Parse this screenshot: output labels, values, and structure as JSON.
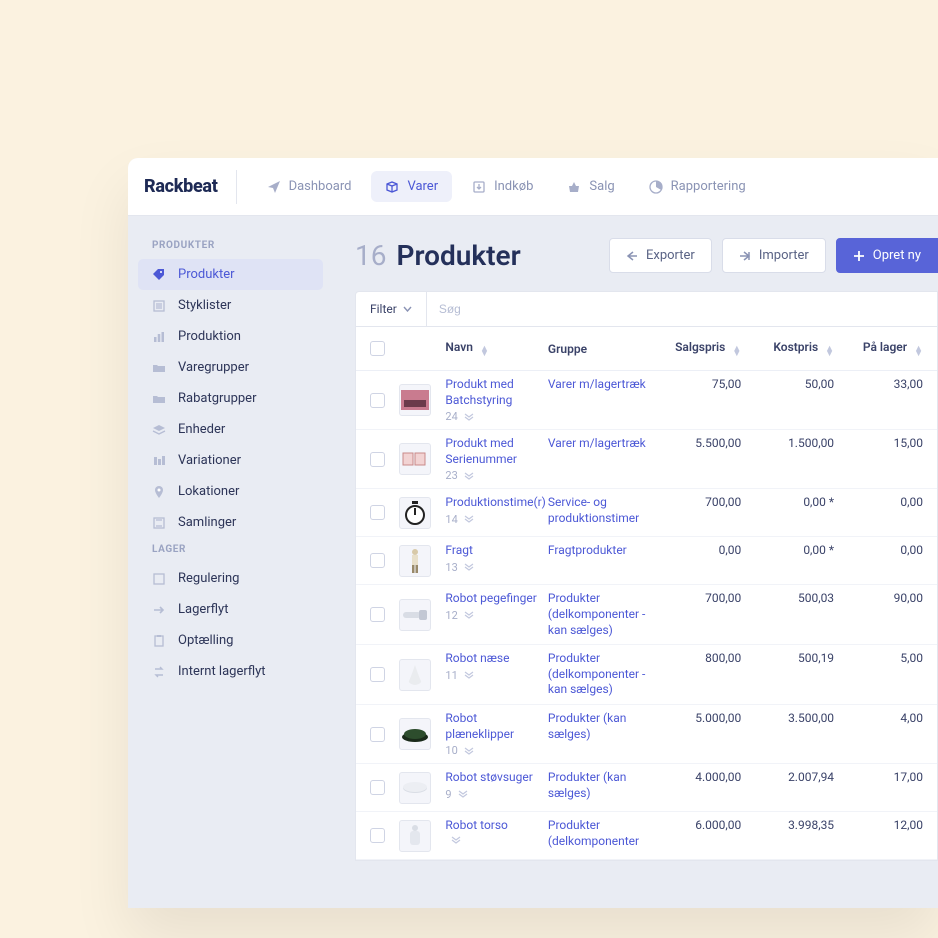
{
  "brand": "Rackbeat",
  "nav": [
    {
      "id": "dashboard",
      "label": "Dashboard",
      "icon": "paper-plane",
      "active": false
    },
    {
      "id": "varer",
      "label": "Varer",
      "icon": "box",
      "active": true
    },
    {
      "id": "indkob",
      "label": "Indkøb",
      "icon": "arrow-down-box",
      "active": false
    },
    {
      "id": "salg",
      "label": "Salg",
      "icon": "basket",
      "active": false
    },
    {
      "id": "rapportering",
      "label": "Rapportering",
      "icon": "pie",
      "active": false
    }
  ],
  "sidebar": {
    "groups": [
      {
        "label": "PRODUKTER",
        "items": [
          {
            "id": "produkter",
            "label": "Produkter",
            "icon": "tag",
            "active": true
          },
          {
            "id": "styklister",
            "label": "Styklister",
            "icon": "list",
            "active": false
          },
          {
            "id": "produktion",
            "label": "Produktion",
            "icon": "bars",
            "active": false
          },
          {
            "id": "varegrupper",
            "label": "Varegrupper",
            "icon": "folder",
            "active": false
          },
          {
            "id": "rabatgrupper",
            "label": "Rabatgrupper",
            "icon": "folder",
            "active": false
          },
          {
            "id": "enheder",
            "label": "Enheder",
            "icon": "layers",
            "active": false
          },
          {
            "id": "variationer",
            "label": "Variationer",
            "icon": "sliders",
            "active": false
          },
          {
            "id": "lokationer",
            "label": "Lokationer",
            "icon": "pin",
            "active": false
          },
          {
            "id": "samlinger",
            "label": "Samlinger",
            "icon": "collection",
            "active": false
          }
        ]
      },
      {
        "label": "LAGER",
        "items": [
          {
            "id": "regulering",
            "label": "Regulering",
            "icon": "square",
            "active": false
          },
          {
            "id": "lagerflyt",
            "label": "Lagerflyt",
            "icon": "arrow-right",
            "active": false
          },
          {
            "id": "optaelling",
            "label": "Optælling",
            "icon": "clipboard",
            "active": false
          },
          {
            "id": "internt",
            "label": "Internt lagerflyt",
            "icon": "swap",
            "active": false
          }
        ]
      }
    ]
  },
  "header": {
    "count": "16",
    "title": "Produkter",
    "export": "Exporter",
    "import": "Importer",
    "create": "Opret ny"
  },
  "filterbar": {
    "filter": "Filter",
    "search_placeholder": "Søg"
  },
  "columns": {
    "name": "Navn",
    "group": "Gruppe",
    "sales": "Salgspris",
    "cost": "Kostpris",
    "stock": "På lager"
  },
  "rows": [
    {
      "name": "Produkt med Batchstyring",
      "seq": "24",
      "group": "Varer m/lagertræk",
      "sales": "75,00",
      "cost": "50,00",
      "stock": "33,00",
      "thumb": "rect-pink"
    },
    {
      "name": "Produkt med Serienummer",
      "seq": "23",
      "group": "Varer m/lagertræk",
      "sales": "5.500,00",
      "cost": "1.500,00",
      "stock": "15,00",
      "thumb": "two-boxes"
    },
    {
      "name": "Produktionstime(r)",
      "seq": "14",
      "group": "Service- og produktionstimer",
      "sales": "700,00",
      "cost": "0,00 *",
      "stock": "0,00",
      "thumb": "stopwatch"
    },
    {
      "name": "Fragt",
      "seq": "13",
      "group": "Fragtprodukter",
      "sales": "0,00",
      "cost": "0,00 *",
      "stock": "0,00",
      "thumb": "person"
    },
    {
      "name": "Robot pegefinger",
      "seq": "12",
      "group": "Produkter (delkomponenter - kan sælges)",
      "sales": "700,00",
      "cost": "500,03",
      "stock": "90,00",
      "thumb": "finger"
    },
    {
      "name": "Robot næse",
      "seq": "11",
      "group": "Produkter (delkomponenter - kan sælges)",
      "sales": "800,00",
      "cost": "500,19",
      "stock": "5,00",
      "thumb": "nose"
    },
    {
      "name": "Robot plæneklipper",
      "seq": "10",
      "group": "Produkter (kan sælges)",
      "sales": "5.000,00",
      "cost": "3.500,00",
      "stock": "4,00",
      "thumb": "mower"
    },
    {
      "name": "Robot støvsuger",
      "seq": "9",
      "group": "Produkter (kan sælges)",
      "sales": "4.000,00",
      "cost": "2.007,94",
      "stock": "17,00",
      "thumb": "disc"
    },
    {
      "name": "Robot torso",
      "seq": "",
      "group": "Produkter (delkomponenter",
      "sales": "6.000,00",
      "cost": "3.998,35",
      "stock": "12,00",
      "thumb": "torso"
    }
  ]
}
